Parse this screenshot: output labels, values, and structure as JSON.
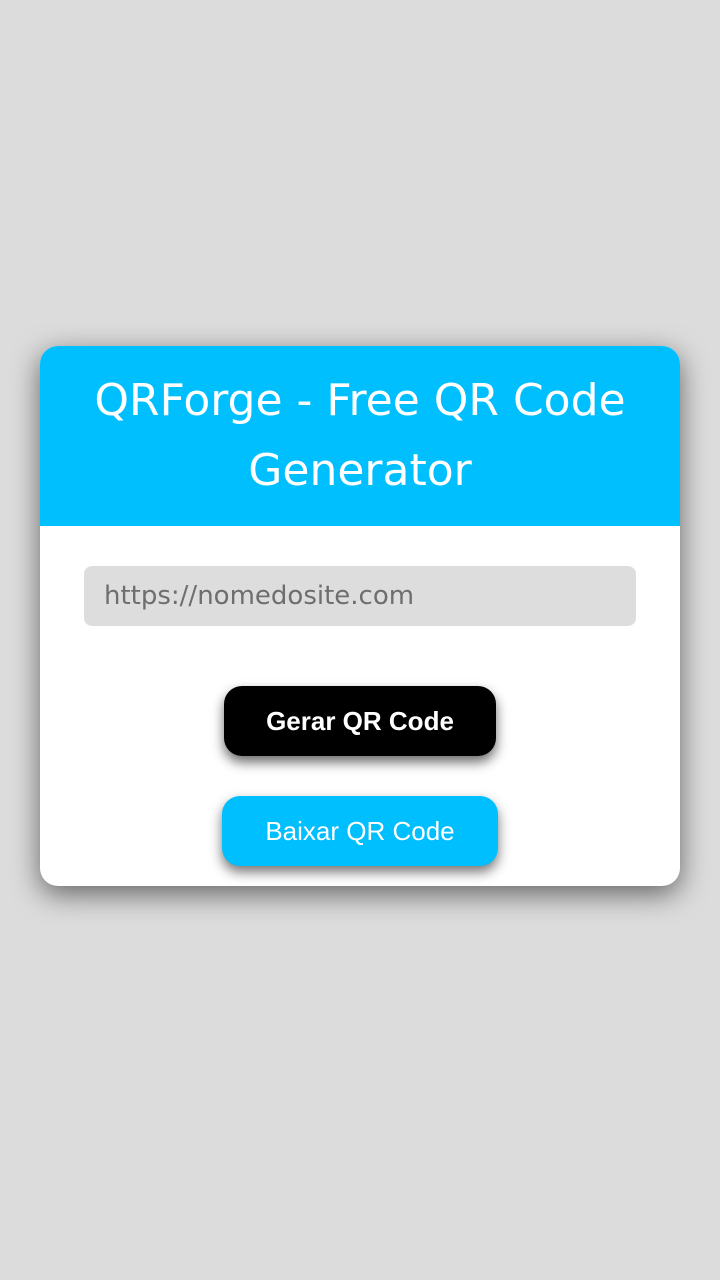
{
  "app": {
    "title": "QRForge - Free QR Code Generator"
  },
  "form": {
    "url_placeholder": "https://nomedosite.com",
    "url_value": ""
  },
  "buttons": {
    "generate_label": "Gerar QR Code",
    "download_label": "Baixar QR Code"
  },
  "colors": {
    "page_background": "#dcdcdc",
    "accent": "#00bfff",
    "card_background": "#ffffff",
    "generate_button": "#000000",
    "input_background": "#dddddd"
  }
}
